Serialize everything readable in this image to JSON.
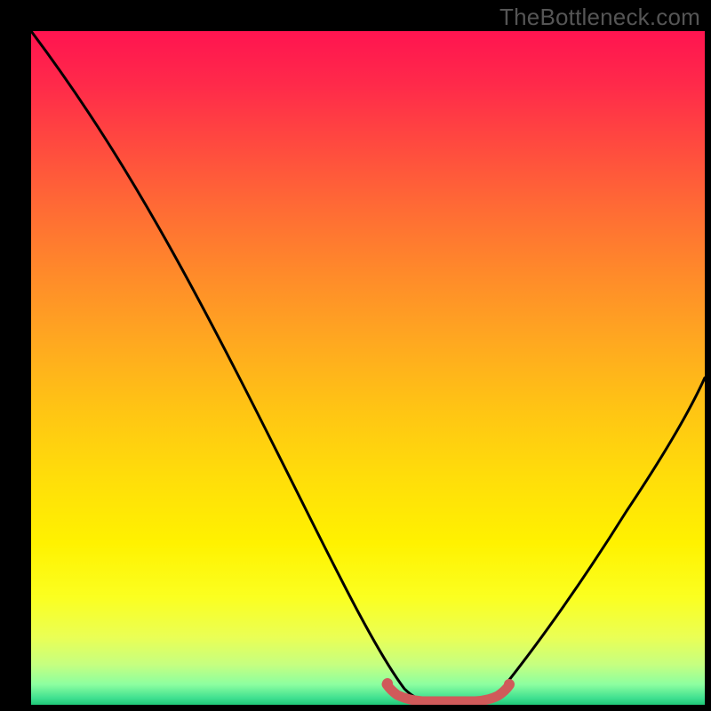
{
  "watermark": "TheBottleneck.com",
  "chart_data": {
    "type": "line",
    "title": "",
    "xlabel": "",
    "ylabel": "",
    "xlim": [
      0,
      100
    ],
    "ylim": [
      0,
      100
    ],
    "series": [
      {
        "name": "bottleneck-curve",
        "x": [
          0,
          5,
          10,
          15,
          20,
          25,
          30,
          35,
          40,
          45,
          50,
          52,
          55,
          60,
          62,
          65,
          70,
          75,
          80,
          85,
          90,
          95,
          100
        ],
        "values": [
          100,
          94,
          87,
          80,
          72,
          64,
          55,
          46,
          37,
          27,
          17,
          12,
          6,
          1,
          0,
          1,
          6,
          14,
          23,
          32,
          41,
          50,
          58
        ]
      },
      {
        "name": "valley-highlight",
        "x": [
          52,
          54,
          56,
          58,
          60,
          62,
          64,
          66,
          68
        ],
        "values": [
          4,
          3,
          2,
          1.2,
          0.8,
          0.7,
          1.0,
          1.6,
          3
        ]
      }
    ],
    "gradient_stops": [
      {
        "pos": 0,
        "color": "#ff1450"
      },
      {
        "pos": 50,
        "color": "#ffc414"
      },
      {
        "pos": 80,
        "color": "#fff200"
      },
      {
        "pos": 100,
        "color": "#20c878"
      }
    ]
  }
}
